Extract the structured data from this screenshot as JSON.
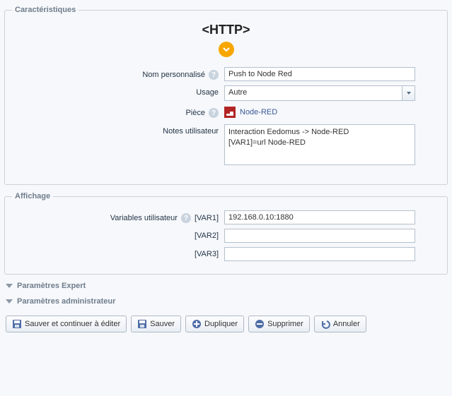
{
  "characteristics": {
    "legend": "Caractéristiques",
    "title": "<HTTP>",
    "labels": {
      "name": "Nom personnalisé",
      "usage": "Usage",
      "piece": "Pièce",
      "notes": "Notes utilisateur"
    },
    "values": {
      "name": "Push to Node Red",
      "usage": "Autre",
      "piece": "Node-RED",
      "notes": "Interaction Eedomus -> Node-RED\n[VAR1]=url Node-RED"
    }
  },
  "display": {
    "legend": "Affichage",
    "labels": {
      "vars": "Variables utilisateur",
      "var1": "[VAR1]",
      "var2": "[VAR2]",
      "var3": "[VAR3]"
    },
    "values": {
      "var1": "192.168.0.10:1880",
      "var2": "",
      "var3": ""
    }
  },
  "expanders": {
    "expert": "Paramètres Expert",
    "admin": "Paramètres administrateur"
  },
  "buttons": {
    "save_continue": "Sauver et continuer à éditer",
    "save": "Sauver",
    "duplicate": "Dupliquer",
    "delete": "Supprimer",
    "cancel": "Annuler"
  }
}
